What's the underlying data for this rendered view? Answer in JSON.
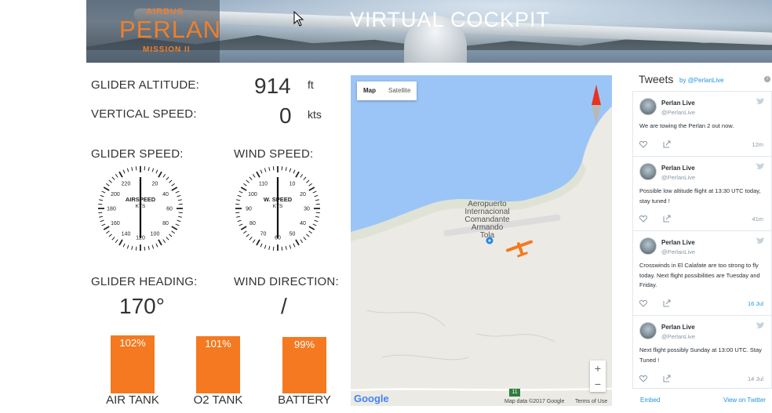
{
  "header": {
    "title": "VIRTUAL COCKPIT",
    "logo": {
      "brand": "AIRBUS",
      "name": "PERLAN",
      "mission": "MISSION II"
    }
  },
  "readouts": {
    "altitude": {
      "label": "GLIDER ALTITUDE:",
      "value": "914",
      "unit": "ft"
    },
    "vertical_speed": {
      "label": "VERTICAL SPEED:",
      "value": "0",
      "unit": "kts"
    },
    "glider_speed": {
      "label": "GLIDER SPEED:",
      "gauge_title": "AIRSPEED",
      "gauge_unit": "KTS",
      "ticks": [
        "20",
        "40",
        "60",
        "80",
        "100",
        "120",
        "140",
        "160",
        "180",
        "200",
        "220"
      ]
    },
    "wind_speed": {
      "label": "WIND SPEED:",
      "gauge_title": "W. SPEED",
      "gauge_unit": "KTS",
      "ticks": [
        "10",
        "20",
        "30",
        "40",
        "50",
        "60",
        "70",
        "80",
        "90",
        "100",
        "110"
      ]
    },
    "heading": {
      "label": "GLIDER HEADING:",
      "value": "170°"
    },
    "wind_direction": {
      "label": "WIND DIRECTION:",
      "value": "/"
    }
  },
  "tanks": [
    {
      "label": "AIR TANK",
      "value": "102%",
      "level": 102
    },
    {
      "label": "O2 TANK",
      "value": "101%",
      "level": 101
    },
    {
      "label": "BATTERY",
      "value": "99%",
      "level": 99
    }
  ],
  "map": {
    "type_buttons": [
      "Map",
      "Satellite"
    ],
    "active_type": "Map",
    "airport_label": "Aeropuerto Internacional Comandante Armando Tola",
    "road_number": "11",
    "zoom_in": "+",
    "zoom_out": "−",
    "google": "Google",
    "credit": "Map data ©2017 Google",
    "terms": "Terms of Use",
    "colors": {
      "water": "#9cc5f7",
      "land": "#eceae4",
      "glider": "#f47920",
      "compass_north": "#e8321f"
    }
  },
  "twitter": {
    "heading": "Tweets",
    "by": "by @PerlanLive",
    "tweets": [
      {
        "name": "Perlan Live",
        "handle": "@PerlanLive",
        "text": "We are towing the Perlan 2 out now.",
        "date": "12m",
        "date_style": "gray"
      },
      {
        "name": "Perlan Live",
        "handle": "@PerlanLive",
        "text": "Possible low altitude flight at 13:30 UTC today, stay tuned !",
        "date": "41m",
        "date_style": "gray"
      },
      {
        "name": "Perlan Live",
        "handle": "@PerlanLive",
        "text": "Crosswinds in El Calafate are too strong to fly today. Next flight possibilities are Tuesday and Friday.",
        "date": "16 Jul",
        "date_style": "blue"
      },
      {
        "name": "Perlan Live",
        "handle": "@PerlanLive",
        "text": "Next flight possibly Sunday at 13:00 UTC. Stay Tuned !",
        "date": "14 Jul",
        "date_style": "gray"
      }
    ],
    "embed": "Embed",
    "view": "View on Twitter"
  }
}
